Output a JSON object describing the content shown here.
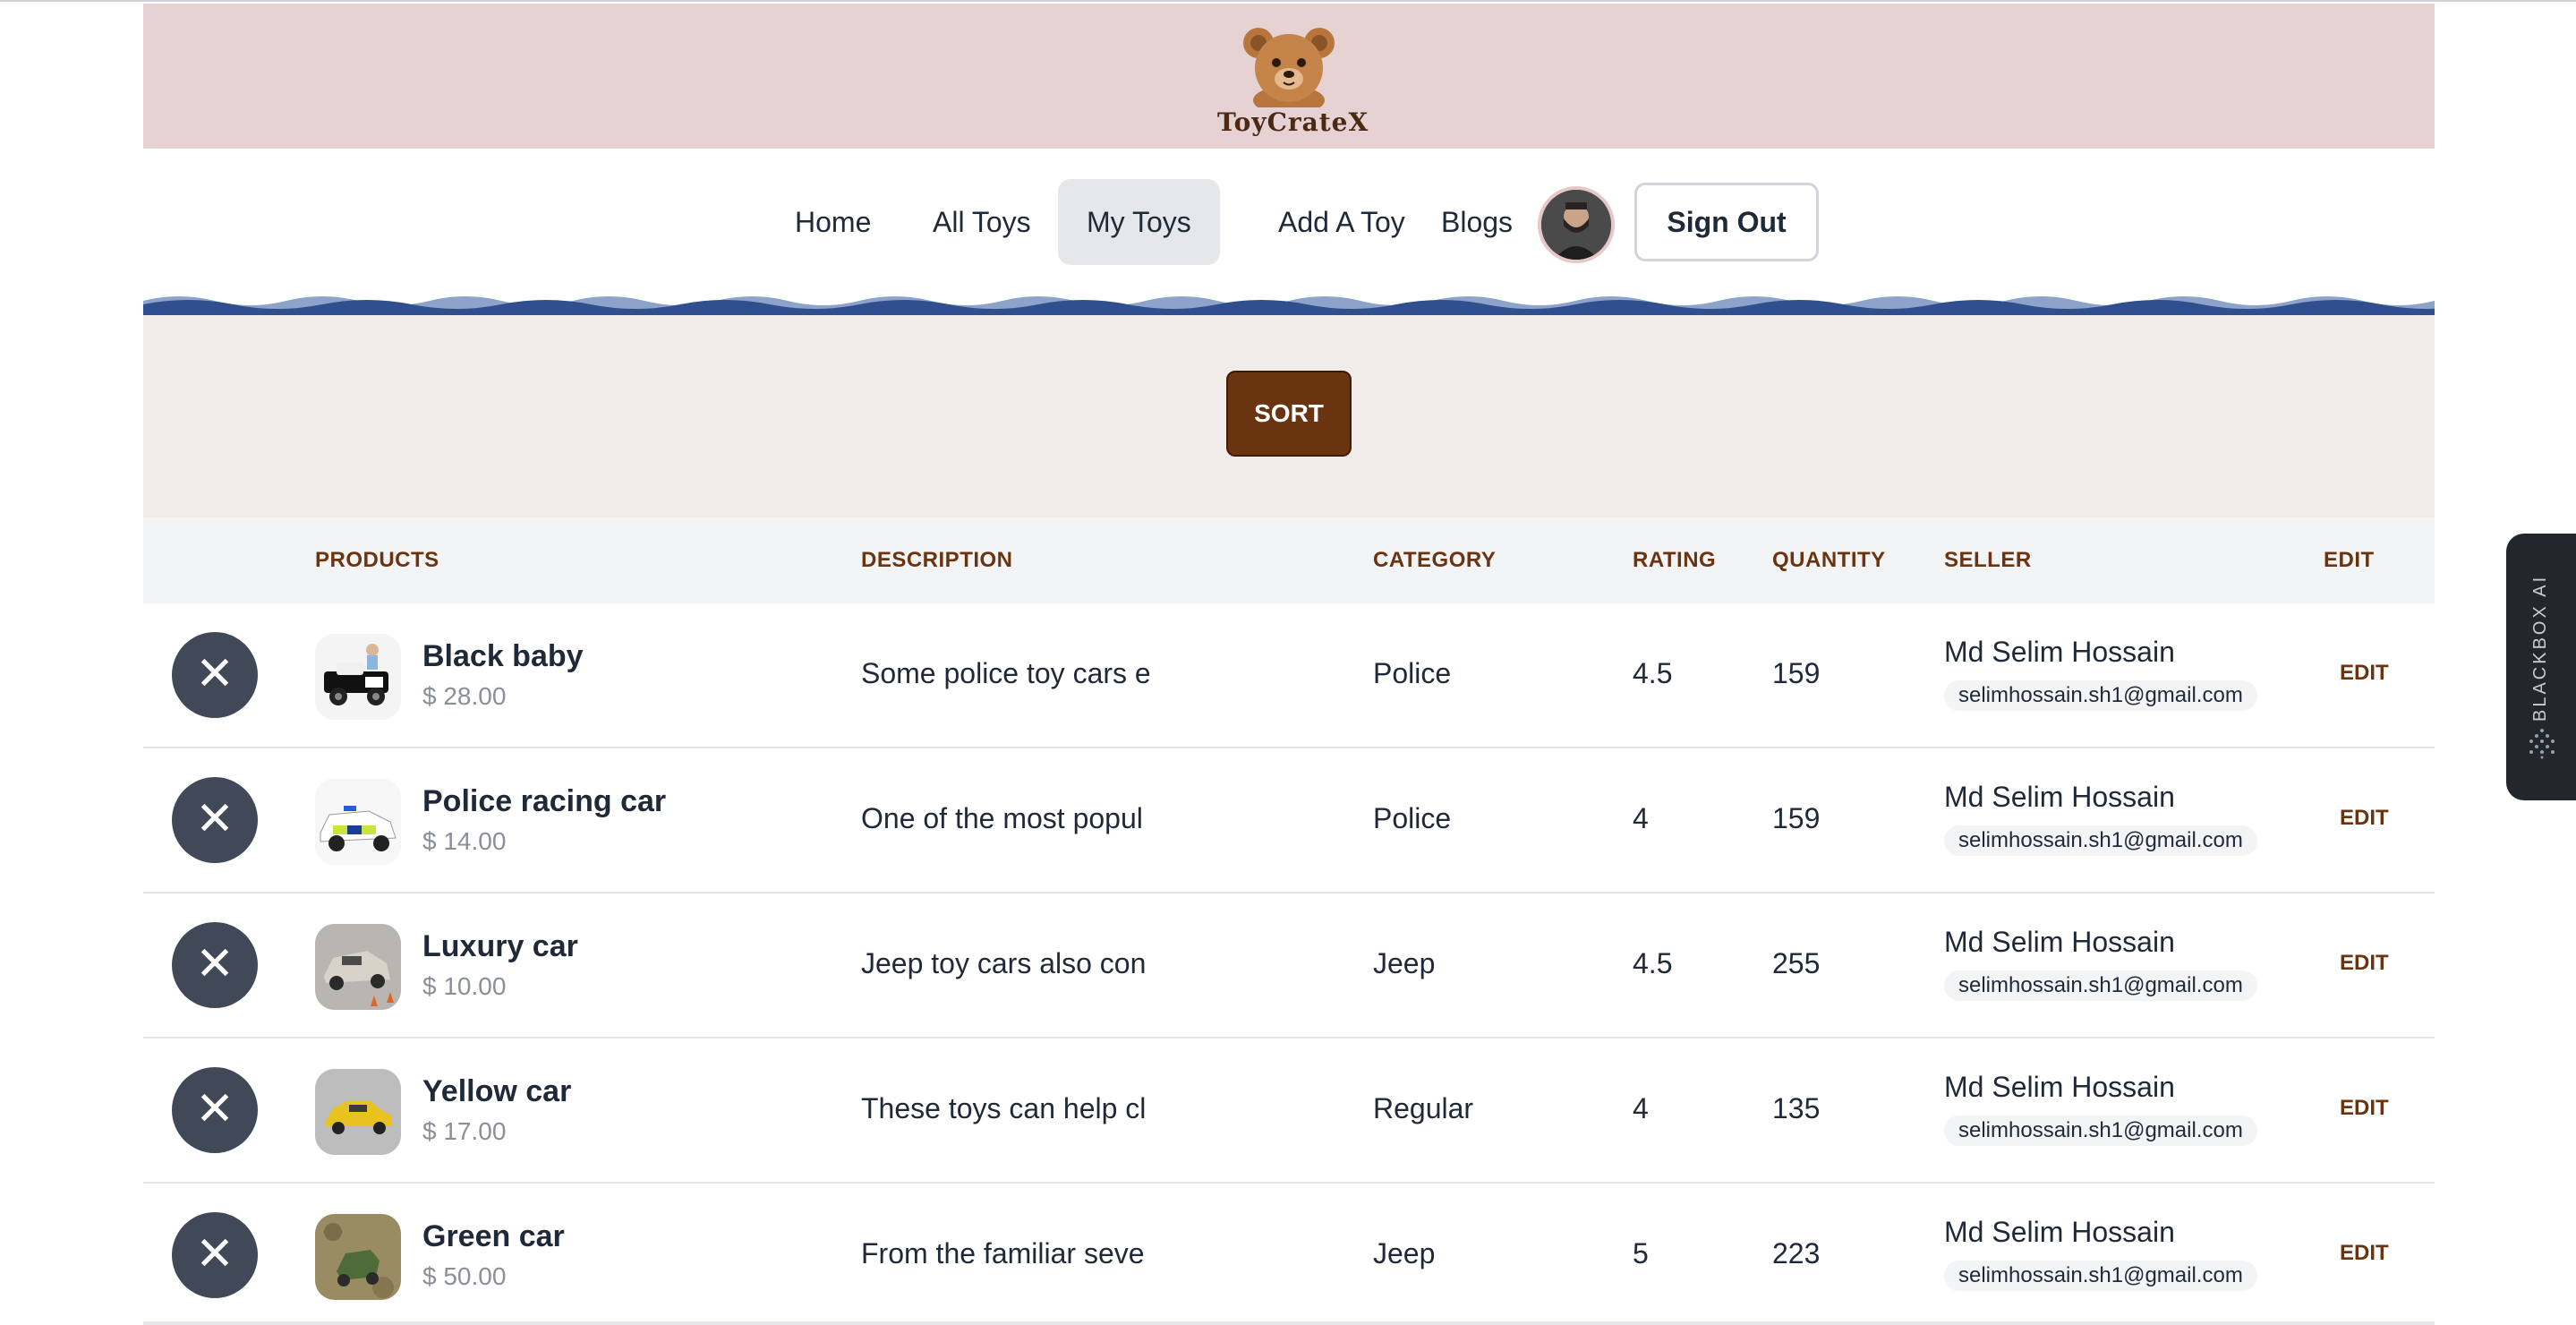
{
  "brand": {
    "name": "ToyCrateX"
  },
  "nav": {
    "items": [
      {
        "label": "Home",
        "active": false
      },
      {
        "label": "All Toys",
        "active": false
      },
      {
        "label": "My Toys",
        "active": true
      },
      {
        "label": "Add A Toy",
        "active": false
      },
      {
        "label": "Blogs",
        "active": false
      }
    ],
    "signout_label": "Sign Out"
  },
  "sort": {
    "label": "SORT"
  },
  "table": {
    "headers": {
      "products": "PRODUCTS",
      "description": "DESCRIPTION",
      "category": "CATEGORY",
      "rating": "RATING",
      "quantity": "QUANTITY",
      "seller": "SELLER",
      "edit": "EDIT"
    },
    "rows": [
      {
        "name": "Black baby",
        "price": "$ 28.00",
        "description": "Some police toy cars e",
        "category": "Police",
        "rating": "4.5",
        "quantity": "159",
        "seller_name": "Md Selim Hossain",
        "seller_email": "selimhossain.sh1@gmail.com",
        "edit_label": "EDIT"
      },
      {
        "name": "Police racing car",
        "price": "$ 14.00",
        "description": "One of the most popul",
        "category": "Police",
        "rating": "4",
        "quantity": "159",
        "seller_name": "Md Selim Hossain",
        "seller_email": "selimhossain.sh1@gmail.com",
        "edit_label": "EDIT"
      },
      {
        "name": "Luxury car",
        "price": "$ 10.00",
        "description": "Jeep toy cars also con",
        "category": "Jeep",
        "rating": "4.5",
        "quantity": "255",
        "seller_name": "Md Selim Hossain",
        "seller_email": "selimhossain.sh1@gmail.com",
        "edit_label": "EDIT"
      },
      {
        "name": "Yellow car",
        "price": "$ 17.00",
        "description": "These toys can help cl",
        "category": "Regular",
        "rating": "4",
        "quantity": "135",
        "seller_name": "Md Selim Hossain",
        "seller_email": "selimhossain.sh1@gmail.com",
        "edit_label": "EDIT"
      },
      {
        "name": "Green car",
        "price": "$ 50.00",
        "description": "From the familiar seve",
        "category": "Jeep",
        "rating": "5",
        "quantity": "223",
        "seller_name": "Md Selim Hossain",
        "seller_email": "selimhossain.sh1@gmail.com",
        "edit_label": "EDIT"
      }
    ]
  },
  "side_tab": {
    "label": "BLACKBOX AI"
  },
  "colors": {
    "header_bg": "#e6d2d3",
    "accent_brown": "#6b3410",
    "wave_blue": "#2f4f8f",
    "delete_button": "#414958"
  }
}
